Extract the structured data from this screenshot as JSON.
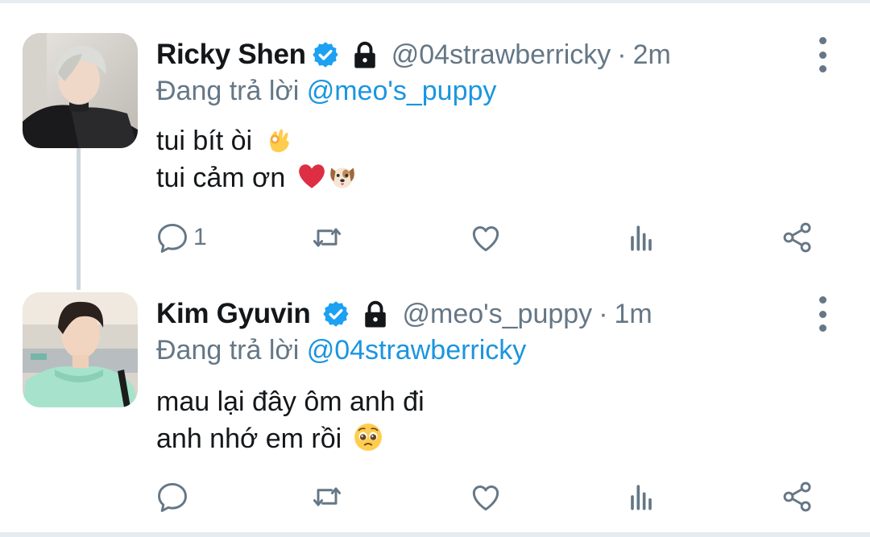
{
  "colors": {
    "text": "#14171a",
    "secondary": "#657786",
    "link": "#1b95e0",
    "verified": "#1da1f2",
    "thread_line": "#ccd6dd"
  },
  "tweets": [
    {
      "display_name": "Ricky Shen",
      "handle": "@04strawberricky",
      "separator": "·",
      "time": "2m",
      "reply_prefix": "Đang trả lời",
      "reply_to": "@meo's_puppy",
      "lines": [
        "tui bít òi",
        "tui cảm ơn"
      ],
      "line_emojis": [
        [
          "ok-hand-emoji"
        ],
        [
          "red-heart-emoji",
          "dog-face-emoji"
        ]
      ],
      "reply_count": "1",
      "icons": [
        "verified-badge-icon",
        "lock-icon",
        "more-vertical-icon",
        "reply-icon",
        "retweet-icon",
        "like-icon",
        "analytics-icon",
        "share-icon"
      ]
    },
    {
      "display_name": "Kim Gyuvin",
      "handle": "@meo's_puppy",
      "separator": "·",
      "time": "1m",
      "reply_prefix": "Đang trả lời",
      "reply_to": "@04strawberricky",
      "lines": [
        "mau lại đây ôm anh đi",
        "anh nhớ em rồi"
      ],
      "line_emojis": [
        [],
        [
          "pleading-face-emoji"
        ]
      ],
      "reply_count": "",
      "icons": [
        "verified-badge-icon",
        "lock-icon",
        "more-vertical-icon",
        "reply-icon",
        "retweet-icon",
        "like-icon",
        "analytics-icon",
        "share-icon"
      ]
    }
  ]
}
